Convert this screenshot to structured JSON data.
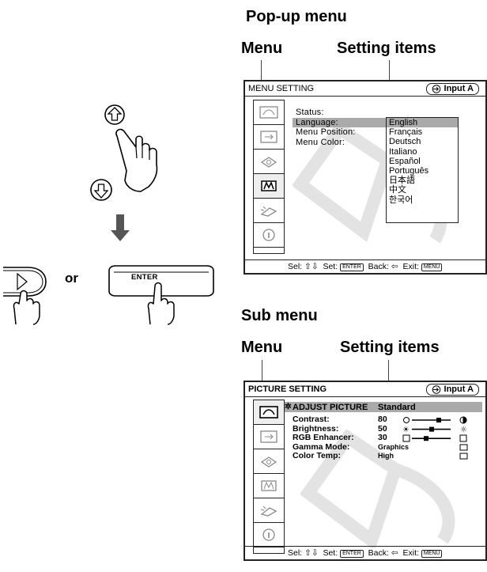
{
  "left": {
    "or_label": "or",
    "enter_key_label": "ENTER"
  },
  "popup": {
    "heading": "Pop-up menu",
    "col_menu": "Menu",
    "col_setting": "Setting items",
    "title": "MENU SETTING",
    "input": "Input A",
    "items": [
      "Status:",
      "Language:",
      "Menu Position:",
      "Menu Color:"
    ],
    "options": [
      "English",
      "Français",
      "Deutsch",
      "Italiano",
      "Español",
      "Português",
      "日本語",
      "中文",
      "한국어"
    ],
    "statusbar": {
      "sel": "Sel:",
      "set": "Set:",
      "set_key": "ENTER",
      "back": "Back:",
      "exit": "Exit:",
      "exit_key": "MENU"
    }
  },
  "sub": {
    "heading": "Sub menu",
    "col_menu": "Menu",
    "col_setting": "Setting items",
    "title": "PICTURE SETTING",
    "input": "Input A",
    "adjust_label": "ADJUST PICTURE",
    "adjust_value": "Standard",
    "rows": [
      {
        "label": "Contrast:",
        "value": "80"
      },
      {
        "label": "Brightness:",
        "value": "50"
      },
      {
        "label": "RGB Enhancer:",
        "value": "30"
      },
      {
        "label": "Gamma Mode:",
        "value": "Graphics"
      },
      {
        "label": "Color Temp:",
        "value": "High"
      }
    ],
    "statusbar": {
      "sel": "Sel:",
      "set": "Set:",
      "set_key": "ENTER",
      "back": "Back:",
      "exit": "Exit:",
      "exit_key": "MENU"
    }
  }
}
